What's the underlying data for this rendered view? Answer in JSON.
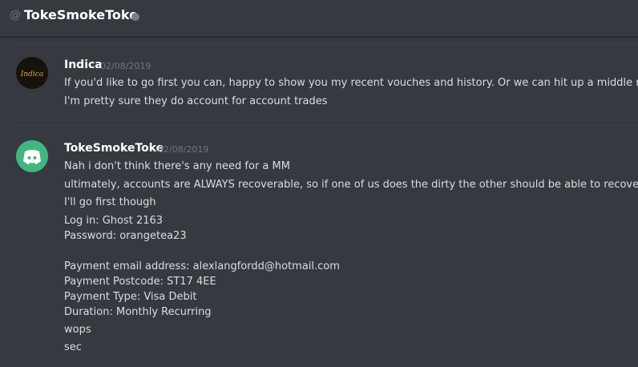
{
  "header": {
    "at_symbol": "@",
    "title": "TokeSmokeToke"
  },
  "messages": [
    {
      "author": "Indica",
      "timestamp": "02/08/2019",
      "avatar_text": "Indica",
      "lines": [
        "If you'd like to go first you can, happy to show you my recent vouches and history. Or we can hit up a middle man",
        "I'm pretty sure they do account for account trades"
      ]
    },
    {
      "author": "TokeSmokeToke",
      "timestamp": "02/08/2019",
      "lines": [
        "Nah i don't think there's any need for a MM",
        "ultimately, accounts are ALWAYS recoverable, so if one of us does the dirty the other should be able to recover",
        "I'll go first though",
        "Log in: Ghost 2163",
        "Password: orangetea23",
        "",
        "Payment email address: alexlangfordd@hotmail.com",
        "Payment Postcode: ST17 4EE",
        "Payment Type: Visa Debit",
        "Duration: Monthly Recurring",
        "wops",
        "sec"
      ]
    }
  ],
  "colors": {
    "background": "#36393f",
    "discord_green": "#43b581",
    "muted": "#72767d"
  }
}
